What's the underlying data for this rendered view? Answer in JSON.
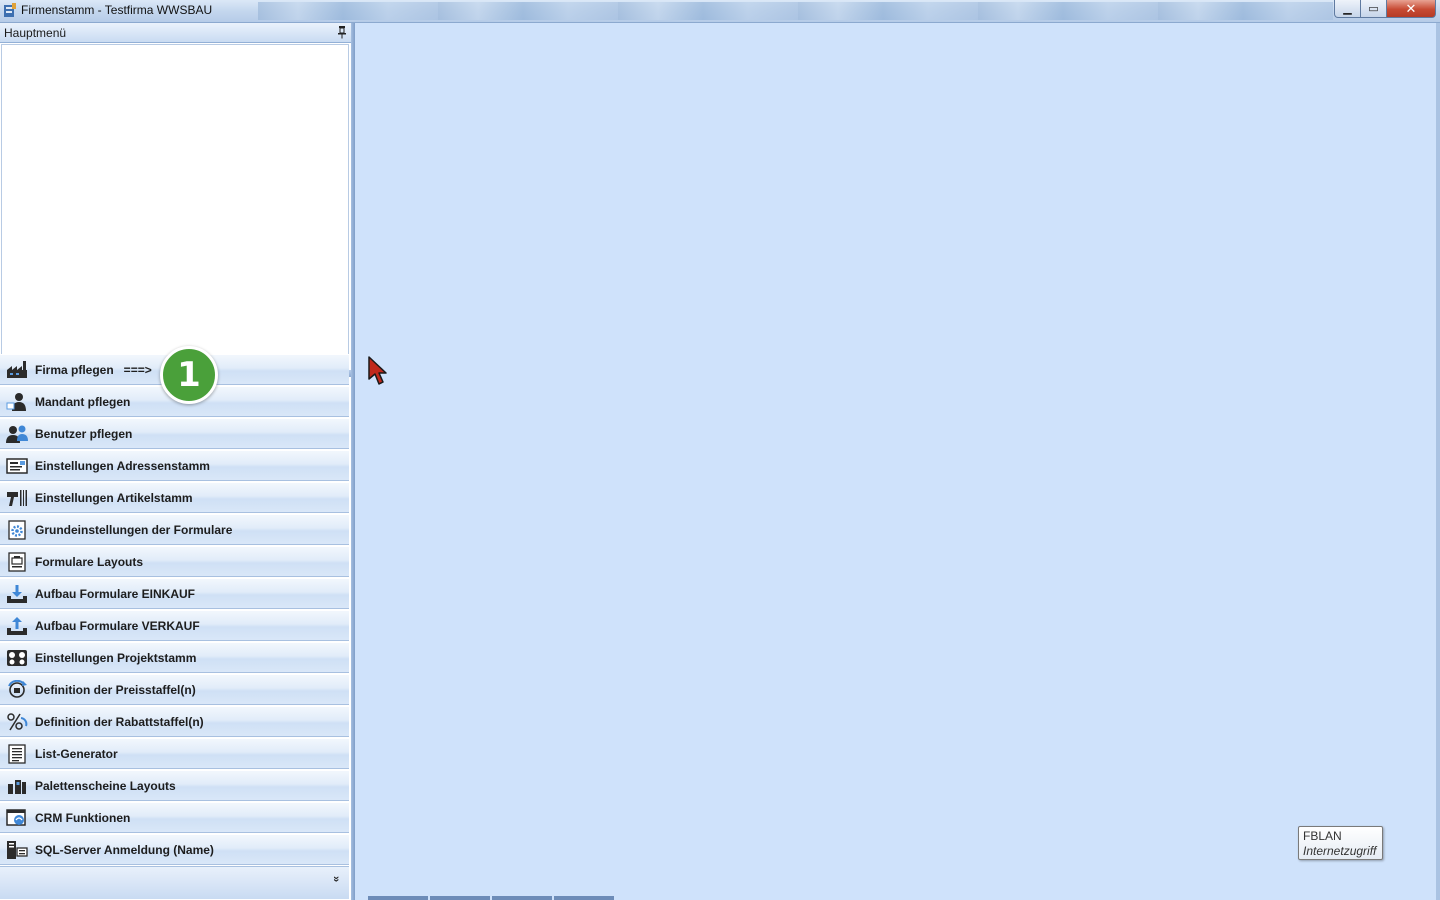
{
  "window": {
    "title": "Firmenstamm - Testfirma WWSBAU",
    "controls": {
      "minimize": "▁",
      "maximize": "▭",
      "close": "✕"
    }
  },
  "panel": {
    "title": "Hauptmenü",
    "pin_icon": "pin-icon"
  },
  "nav": {
    "items": [
      {
        "label": "Firma pflegen   ===>",
        "icon": "factory-icon"
      },
      {
        "label": "Mandant pflegen",
        "icon": "user-client-icon"
      },
      {
        "label": "Benutzer pflegen",
        "icon": "users-icon"
      },
      {
        "label": "Einstellungen Adressenstamm",
        "icon": "address-card-icon"
      },
      {
        "label": "Einstellungen Artikelstamm",
        "icon": "barcode-scanner-icon"
      },
      {
        "label": "Grundeinstellungen der Formulare",
        "icon": "form-settings-icon"
      },
      {
        "label": "Formulare Layouts",
        "icon": "form-layout-icon"
      },
      {
        "label": "Aufbau Formulare EINKAUF",
        "icon": "tray-download-icon"
      },
      {
        "label": "Aufbau Formulare VERKAUF",
        "icon": "tray-upload-icon"
      },
      {
        "label": "Einstellungen Projektstamm",
        "icon": "project-icon"
      },
      {
        "label": "Definition der Preisstaffel(n)",
        "icon": "price-scale-icon"
      },
      {
        "label": "Definition der Rabattstaffel(n)",
        "icon": "discount-icon"
      },
      {
        "label": "List-Generator",
        "icon": "list-icon"
      },
      {
        "label": "Palettenscheine Layouts",
        "icon": "pallet-icon"
      },
      {
        "label": "CRM Funktionen",
        "icon": "crm-icon"
      },
      {
        "label": "SQL-Server Anmeldung (Name)",
        "icon": "sql-server-icon"
      }
    ],
    "overflow_chevron": "»"
  },
  "annotation": {
    "badge_number": "1"
  },
  "tooltip": {
    "line1": "FBLAN",
    "line2": "Internetzugriff"
  },
  "colors": {
    "workspace": "#cfe2fb",
    "badge": "#4aa03a",
    "close_button": "#c74a33"
  }
}
